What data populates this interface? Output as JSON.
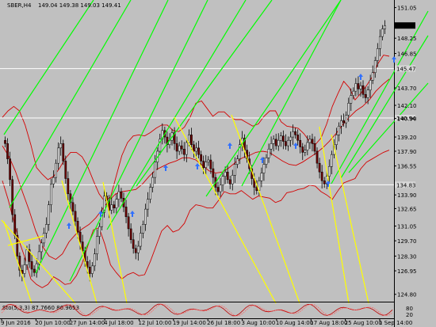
{
  "header": {
    "symbol": "SBER,H4",
    "ohlc": "149.04 149.38 149.03 149.41"
  },
  "oscillator": {
    "label": "Sto(5,3,3) 87.7660 86.9653",
    "scale_top": "80",
    "scale_bottom": "20"
  },
  "colors": {
    "background": "#c0c0c0",
    "candle": "#8b0000",
    "bands": "#d40000",
    "trend_up": "#00ff00",
    "trend_down": "#ffff00",
    "hline": "#ffffff",
    "arrow": "#3070ff",
    "stoch": "#c00000"
  },
  "chart_data": {
    "type": "candlestick",
    "x_ticks": [
      "9 Jun 2016",
      "20 Jun 10:00",
      "27 Jun 14:00",
      "4 Jul 18:00",
      "12 Jul 10:00",
      "19 Jul 14:00",
      "26 Jul 18:00",
      "3 Aug 10:00",
      "10 Aug 14:00",
      "17 Aug 18:00",
      "25 Aug 10:00",
      "1 Sep 14:00"
    ],
    "y_ticks": [
      151.05,
      149.41,
      148.25,
      146.85,
      145.47,
      143.7,
      142.1,
      140.9,
      139.2,
      137.9,
      136.55,
      134.83,
      133.9,
      132.65,
      131.05,
      129.7,
      128.3,
      126.95,
      124.8
    ],
    "ylim": [
      124.2,
      151.6
    ],
    "current_price": 149.41,
    "horizontal_levels": [
      145.47,
      140.94,
      134.83
    ],
    "horizontal_level_labels": [
      "145.47",
      "140.94",
      "134.83"
    ],
    "close_series": [
      138.6,
      137.2,
      135.3,
      132.1,
      130.2,
      128.3,
      127.0,
      126.7,
      127.5,
      128.9,
      127.8,
      127.1,
      126.8,
      127.6,
      128.7,
      129.5,
      130.4,
      131.2,
      133.0,
      134.9,
      135.5,
      136.8,
      138.2,
      138.6,
      137.0,
      135.4,
      134.0,
      133.2,
      132.4,
      131.5,
      130.5,
      129.6,
      128.8,
      127.8,
      127.3,
      126.7,
      127.4,
      128.5,
      130.1,
      131.0,
      132.3,
      133.8,
      133.4,
      132.5,
      133.0,
      132.7,
      133.5,
      134.2,
      133.6,
      132.8,
      131.9,
      130.8,
      129.8,
      129.0,
      128.6,
      129.2,
      130.4,
      131.2,
      132.6,
      133.5,
      134.6,
      135.5,
      136.9,
      137.9,
      139.0,
      139.8,
      139.2,
      138.5,
      138.9,
      139.6,
      138.6,
      137.9,
      138.4,
      138.1,
      137.6,
      138.7,
      139.4,
      138.5,
      137.9,
      138.2,
      137.6,
      137.0,
      136.4,
      136.9,
      137.1,
      136.3,
      135.5,
      134.6,
      134.2,
      134.8,
      135.6,
      136.0,
      135.3,
      134.9,
      135.7,
      136.7,
      137.2,
      138.5,
      139.1,
      138.0,
      137.2,
      136.3,
      135.4,
      134.6,
      134.3,
      135.2,
      135.9,
      136.7,
      137.3,
      138.1,
      138.6,
      139.0,
      138.4,
      138.9,
      139.3,
      138.8,
      138.4,
      138.9,
      139.2,
      139.7,
      139.4,
      138.9,
      138.3,
      137.8,
      138.0,
      138.7,
      139.0,
      138.6,
      137.9,
      136.8,
      136.0,
      135.2,
      134.9,
      135.6,
      136.5,
      137.6,
      138.5,
      139.4,
      140.2,
      140.7,
      140.5,
      141.2,
      142.3,
      143.0,
      143.4,
      144.1,
      143.6,
      143.9,
      143.1,
      142.8,
      143.5,
      144.4,
      145.1,
      146.2,
      147.3,
      148.4,
      149.1,
      149.4
    ],
    "bollinger_upper": [
      141.0,
      141.6,
      142.0,
      141.6,
      140.3,
      138.5,
      136.4,
      135.8,
      135.3,
      135.6,
      136.3,
      137.2,
      137.8,
      137.8,
      137.4,
      136.5,
      135.2,
      134.0,
      133.3,
      133.7,
      135.6,
      137.5,
      138.7,
      139.3,
      139.4,
      139.3,
      139.6,
      140.0,
      140.3,
      140.3,
      139.8,
      139.7,
      140.1,
      141.0,
      142.3,
      142.5,
      141.8,
      141.1,
      141.5,
      141.5,
      141.0,
      140.8,
      140.8,
      140.5,
      140.2,
      140.4,
      141.1,
      141.6,
      141.6,
      140.6,
      140.2,
      140.1,
      140.0,
      139.5,
      138.8,
      138.5,
      139.1,
      140.4,
      142.0,
      143.2,
      144.3,
      143.7,
      142.6,
      143.2,
      143.9,
      144.7,
      145.9,
      146.7,
      146.6
    ],
    "bollinger_lower": [
      135.2,
      133.5,
      131.5,
      129.6,
      128.1,
      126.2,
      125.7,
      125.4,
      125.7,
      126.4,
      126.1,
      125.7,
      125.8,
      126.5,
      127.6,
      129.2,
      130.7,
      130.9,
      129.4,
      127.5,
      126.8,
      126.2,
      126.6,
      126.8,
      126.5,
      126.6,
      127.8,
      129.2,
      130.6,
      131.1,
      130.5,
      130.7,
      131.3,
      132.5,
      133.0,
      132.9,
      132.7,
      132.7,
      133.4,
      134.2,
      134.0,
      134.0,
      134.3,
      133.9,
      133.5,
      133.8,
      133.7,
      133.6,
      133.2,
      133.4,
      134.1,
      134.2,
      134.4,
      134.5,
      134.8,
      134.7,
      134.2,
      133.9,
      133.5,
      134.3,
      135.0,
      135.2,
      135.4,
      136.3,
      136.9,
      137.2,
      137.5,
      137.8,
      138.0
    ],
    "bollinger_mid": [
      138.4,
      137.4,
      136.0,
      134.2,
      132.5,
      130.6,
      129.2,
      128.3,
      128.0,
      128.5,
      129.6,
      130.3,
      130.8,
      131.2,
      131.8,
      132.6,
      133.4,
      134.0,
      134.2,
      134.3,
      134.4,
      134.9,
      135.6,
      136.2,
      136.5,
      136.8,
      137.0,
      137.3,
      137.3,
      137.1,
      136.6,
      136.1,
      135.9,
      136.0,
      136.4,
      136.9,
      137.3,
      137.5,
      137.8,
      137.9,
      137.8,
      137.4,
      137.0,
      136.7,
      136.6,
      136.9,
      137.3,
      137.7,
      138.2,
      138.8,
      139.5,
      140.3,
      141.0,
      141.6,
      142.0,
      142.6,
      143.4,
      144.0,
      144.5
    ],
    "series": [
      {
        "name": "Sto(5,3,3) main",
        "last": 87.766
      },
      {
        "name": "Sto(5,3,3) signal",
        "last": 86.9653
      }
    ]
  }
}
